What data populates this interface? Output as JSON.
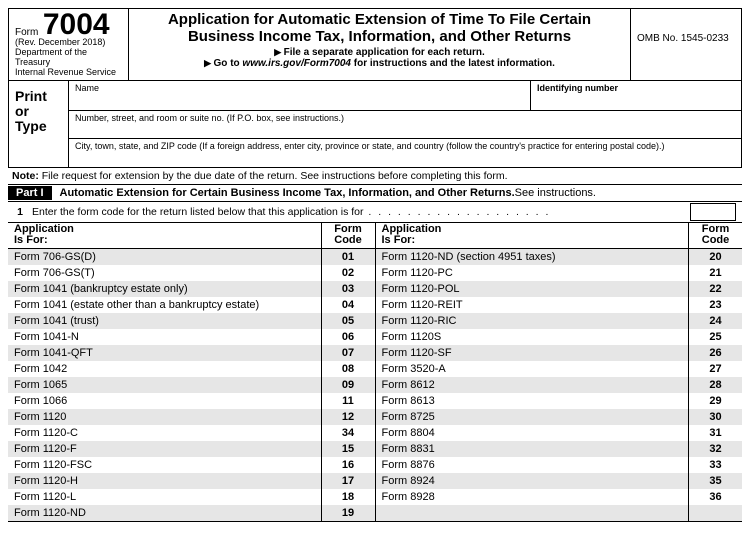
{
  "header": {
    "form_word": "Form",
    "form_number": "7004",
    "revision": "(Rev. December 2018)",
    "dept": "Department of the Treasury",
    "irs": "Internal Revenue Service",
    "title_line1": "Application for Automatic Extension of Time To File Certain",
    "title_line2": "Business Income Tax, Information, and Other Returns",
    "sub1": "File a separate application for each return.",
    "sub2_pre": "Go to ",
    "sub2_url": "www.irs.gov/Form7004",
    "sub2_post": " for instructions and the latest information.",
    "omb": "OMB No. 1545-0233"
  },
  "identity": {
    "print_or_type_l1": "Print",
    "print_or_type_l2": "or",
    "print_or_type_l3": "Type",
    "name_label": "Name",
    "idnum_label": "Identifying number",
    "addr_label": "Number, street, and room or suite no. (If P.O. box, see instructions.)",
    "city_label": "City, town, state, and ZIP code (If a foreign address, enter city, province or state, and country (follow the country's practice for entering postal code).)"
  },
  "note": {
    "bold": "Note:",
    "text": " File request for extension by the due date of the return. See instructions before completing this form."
  },
  "part1": {
    "label": "Part I",
    "title_bold": "Automatic Extension for Certain Business Income Tax, Information, and Other Returns.",
    "title_tail": " See instructions.",
    "line1_num": "1",
    "line1_text": "Enter the form code for the return listed below that this application is for"
  },
  "table": {
    "app_for_l1": "Application",
    "app_for_l2": "Is For:",
    "code_l1": "Form",
    "code_l2": "Code",
    "left": [
      {
        "name": "Form 706-GS(D)",
        "code": "01"
      },
      {
        "name": "Form 706-GS(T)",
        "code": "02"
      },
      {
        "name": "Form 1041 (bankruptcy estate only)",
        "code": "03"
      },
      {
        "name": "Form 1041 (estate other than a bankruptcy estate)",
        "code": "04"
      },
      {
        "name": "Form 1041 (trust)",
        "code": "05"
      },
      {
        "name": "Form 1041-N",
        "code": "06"
      },
      {
        "name": "Form 1041-QFT",
        "code": "07"
      },
      {
        "name": "Form 1042",
        "code": "08"
      },
      {
        "name": "Form 1065",
        "code": "09"
      },
      {
        "name": "Form 1066",
        "code": "11"
      },
      {
        "name": "Form 1120",
        "code": "12"
      },
      {
        "name": "Form 1120-C",
        "code": "34"
      },
      {
        "name": "Form 1120-F",
        "code": "15"
      },
      {
        "name": "Form 1120-FSC",
        "code": "16"
      },
      {
        "name": "Form 1120-H",
        "code": "17"
      },
      {
        "name": "Form 1120-L",
        "code": "18"
      },
      {
        "name": "Form 1120-ND",
        "code": "19"
      }
    ],
    "right": [
      {
        "name": "Form 1120-ND (section 4951 taxes)",
        "code": "20"
      },
      {
        "name": "Form 1120-PC",
        "code": "21"
      },
      {
        "name": "Form 1120-POL",
        "code": "22"
      },
      {
        "name": "Form 1120-REIT",
        "code": "23"
      },
      {
        "name": "Form 1120-RIC",
        "code": "24"
      },
      {
        "name": "Form 1120S",
        "code": "25"
      },
      {
        "name": "Form 1120-SF",
        "code": "26"
      },
      {
        "name": "Form 3520-A",
        "code": "27"
      },
      {
        "name": "Form 8612",
        "code": "28"
      },
      {
        "name": "Form 8613",
        "code": "29"
      },
      {
        "name": "Form 8725",
        "code": "30"
      },
      {
        "name": "Form 8804",
        "code": "31"
      },
      {
        "name": "Form 8831",
        "code": "32"
      },
      {
        "name": "Form 8876",
        "code": "33"
      },
      {
        "name": "Form 8924",
        "code": "35"
      },
      {
        "name": "Form 8928",
        "code": "36"
      },
      {
        "name": "",
        "code": ""
      }
    ]
  }
}
